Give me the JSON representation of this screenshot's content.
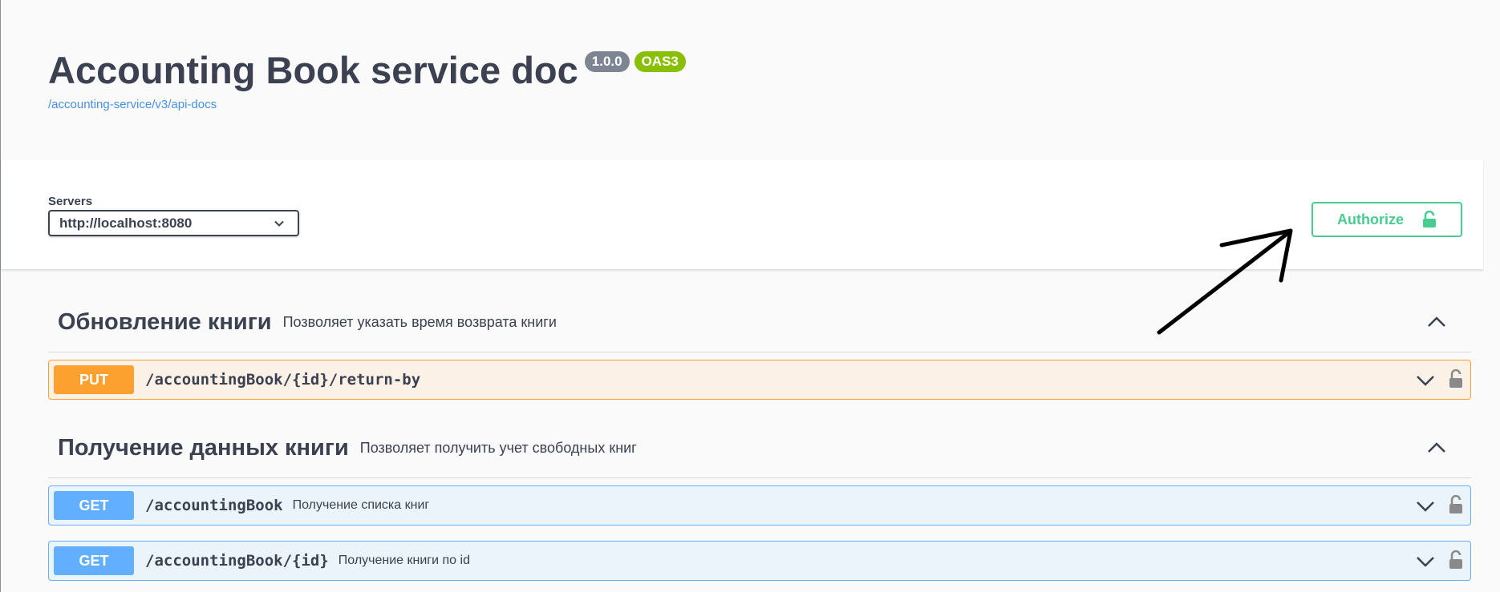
{
  "info": {
    "title": "Accounting Book service doc",
    "version": "1.0.0",
    "oas": "OAS3",
    "url": "/accounting-service/v3/api-docs"
  },
  "servers": {
    "label": "Servers",
    "selected": "http://localhost:8080"
  },
  "authorize": {
    "label": "Authorize",
    "icon": "unlock-icon",
    "color": "#49cc90"
  },
  "tags": [
    {
      "name": "Обновление книги",
      "description": "Позволяет указать время возврата книги",
      "operations": [
        {
          "method": "PUT",
          "path": "/accountingBook/{id}/return-by",
          "summary": "",
          "color": "#fca130"
        }
      ]
    },
    {
      "name": "Получение данных книги",
      "description": "Позволяет получить учет свободных книг",
      "operations": [
        {
          "method": "GET",
          "path": "/accountingBook",
          "summary": "Получение списка книг",
          "color": "#61affe"
        },
        {
          "method": "GET",
          "path": "/accountingBook/{id}",
          "summary": "Получение книги по id",
          "color": "#61affe"
        }
      ]
    }
  ]
}
